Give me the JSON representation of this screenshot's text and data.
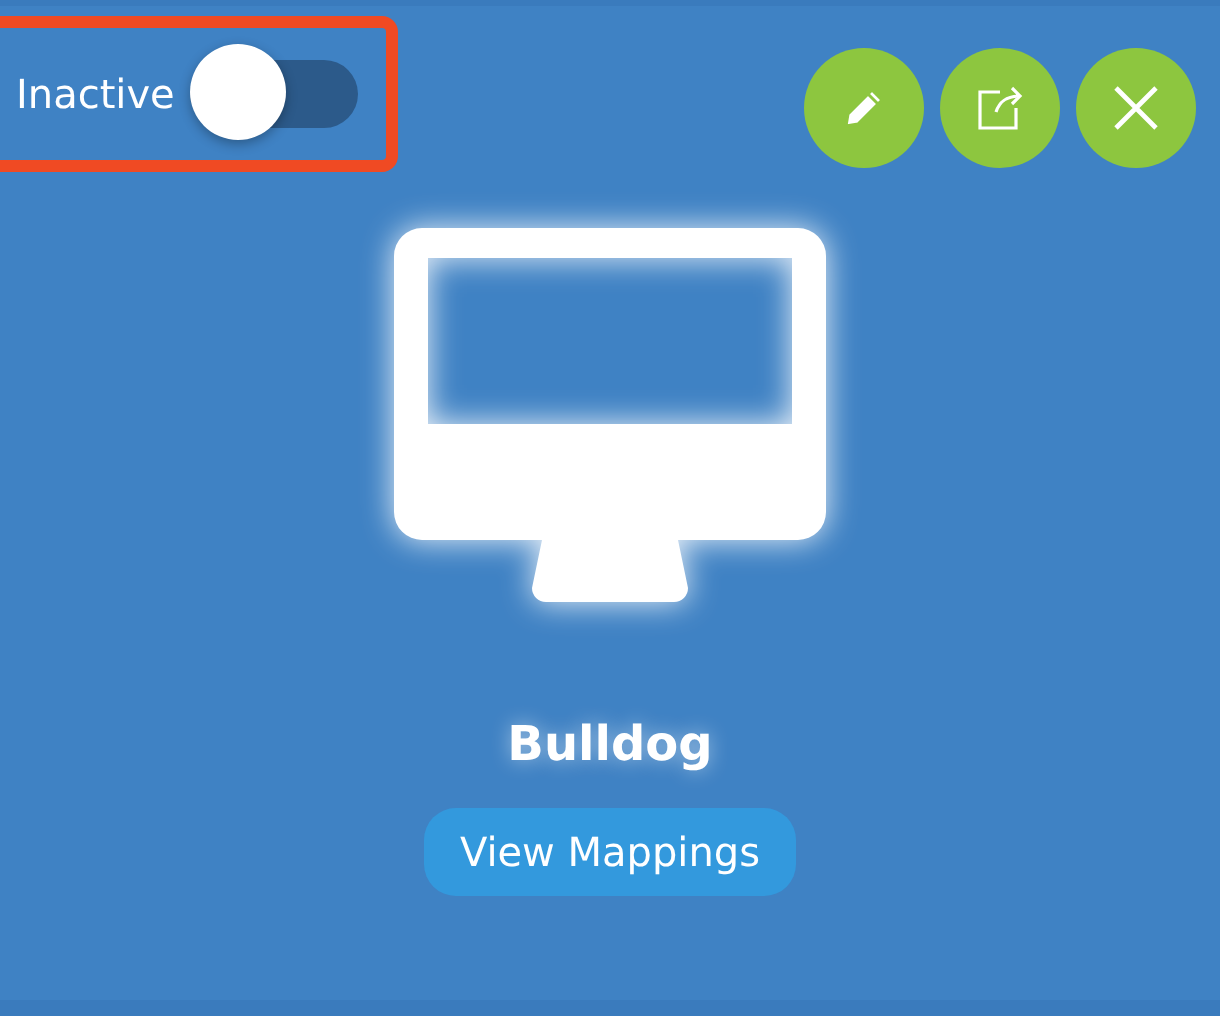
{
  "status_toggle": {
    "label": "Inactive",
    "on": false,
    "highlighted": true
  },
  "actions": [
    {
      "kind": "edit"
    },
    {
      "kind": "external"
    },
    {
      "kind": "close"
    }
  ],
  "device": {
    "kind": "monitor",
    "name": "Bulldog"
  },
  "button": "View Mappings"
}
